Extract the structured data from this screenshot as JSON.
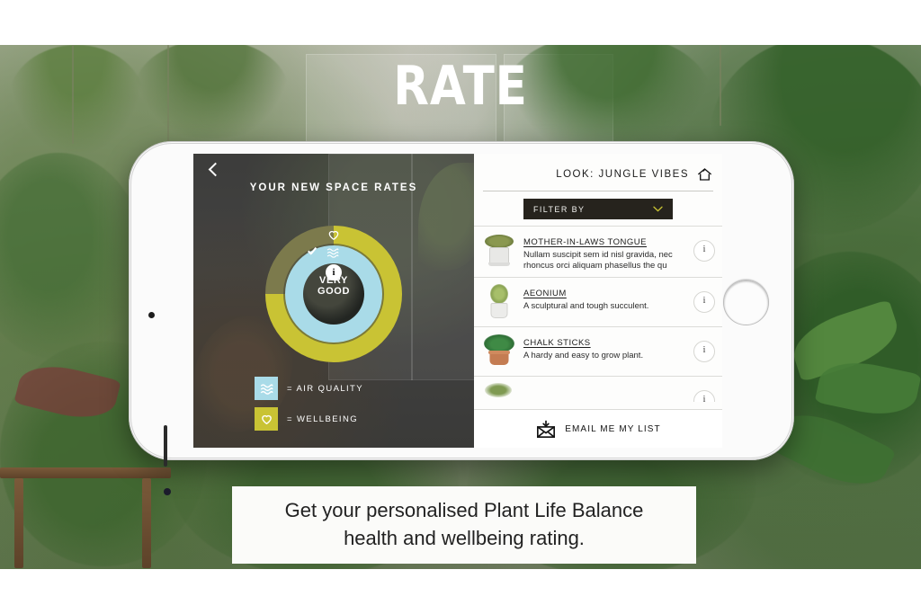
{
  "slide": {
    "title": "RATE",
    "caption_line1": "Get your personalised Plant Life Balance",
    "caption_line2": "health and wellbeing rating."
  },
  "app": {
    "left_panel": {
      "back_icon": "chevron-left-icon",
      "heading": "YOUR NEW SPACE RATES",
      "rating": {
        "label_line1": "VERY",
        "label_line2": "GOOD",
        "info_glyph": "i",
        "outer_ring_color": "#c9c334",
        "outer_ring_track_color": "#7c7a4c",
        "outer_ring_filled_degrees": 270,
        "inner_ring_color": "#a9dbe8",
        "inner_ring_filled_degrees": 360,
        "outer_icon": "heart-icon",
        "inner_icons": [
          "check-icon",
          "waves-icon"
        ]
      },
      "legend": [
        {
          "icon": "waves-icon",
          "swatch_color": "#a9dbe8",
          "label": "= AIR QUALITY"
        },
        {
          "icon": "heart-icon",
          "swatch_color": "#c9c334",
          "label": "= WELLBEING"
        }
      ]
    },
    "right_panel": {
      "title": "LOOK: JUNGLE VIBES",
      "home_icon": "home-icon",
      "filter": {
        "label": "FILTER BY",
        "chevron_icon": "chevron-down-icon",
        "background_color": "#26231d",
        "chevron_color": "#c9c334"
      },
      "plants": [
        {
          "name": "MOTHER-IN-LAWS TONGUE",
          "description": "Nullam suscipit sem id nisl gravida, nec rhoncus orci aliquam phasellus the qu",
          "info_glyph": "i",
          "thumb": "plant-thumbnail-bushy-white-pot"
        },
        {
          "name": "AEONIUM",
          "description": "A sculptural and tough succulent.",
          "info_glyph": "i",
          "thumb": "plant-thumbnail-stalk-white-pot"
        },
        {
          "name": "CHALK STICKS",
          "description": "A hardy and easy to grow plant.",
          "info_glyph": "i",
          "thumb": "plant-thumbnail-broadleaf-terracotta-pot"
        },
        {
          "name": "",
          "description": "",
          "info_glyph": "i",
          "thumb": "plant-thumbnail-partial"
        }
      ],
      "email_action": {
        "label": "EMAIL ME MY LIST",
        "icon": "envelope-download-icon"
      }
    },
    "device": {
      "home_button": "home-button",
      "earpiece": "earpiece-speaker",
      "camera": "front-camera",
      "sensor": "proximity-sensor"
    }
  }
}
